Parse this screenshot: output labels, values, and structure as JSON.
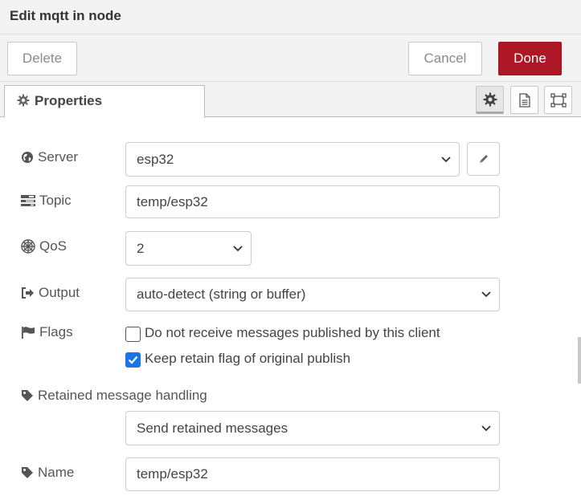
{
  "dialog": {
    "title": "Edit mqtt in node"
  },
  "toolbar": {
    "delete_label": "Delete",
    "cancel_label": "Cancel",
    "done_label": "Done"
  },
  "tabs": {
    "properties_label": "Properties"
  },
  "form": {
    "server": {
      "label": "Server",
      "value": "esp32"
    },
    "topic": {
      "label": "Topic",
      "value": "temp/esp32"
    },
    "qos": {
      "label": "QoS",
      "value": "2"
    },
    "output": {
      "label": "Output",
      "value": "auto-detect (string or buffer)"
    },
    "flags": {
      "label": "Flags",
      "no_local_label": "Do not receive messages published by this client",
      "no_local_checked": false,
      "retain_label": "Keep retain flag of original publish",
      "retain_checked": true
    },
    "retained": {
      "label": "Retained message handling",
      "value": "Send retained messages"
    },
    "name": {
      "label": "Name",
      "value": "temp/esp32"
    }
  },
  "colors": {
    "done_button": "#ad1625",
    "checkbox_checked": "#1a73e8"
  }
}
